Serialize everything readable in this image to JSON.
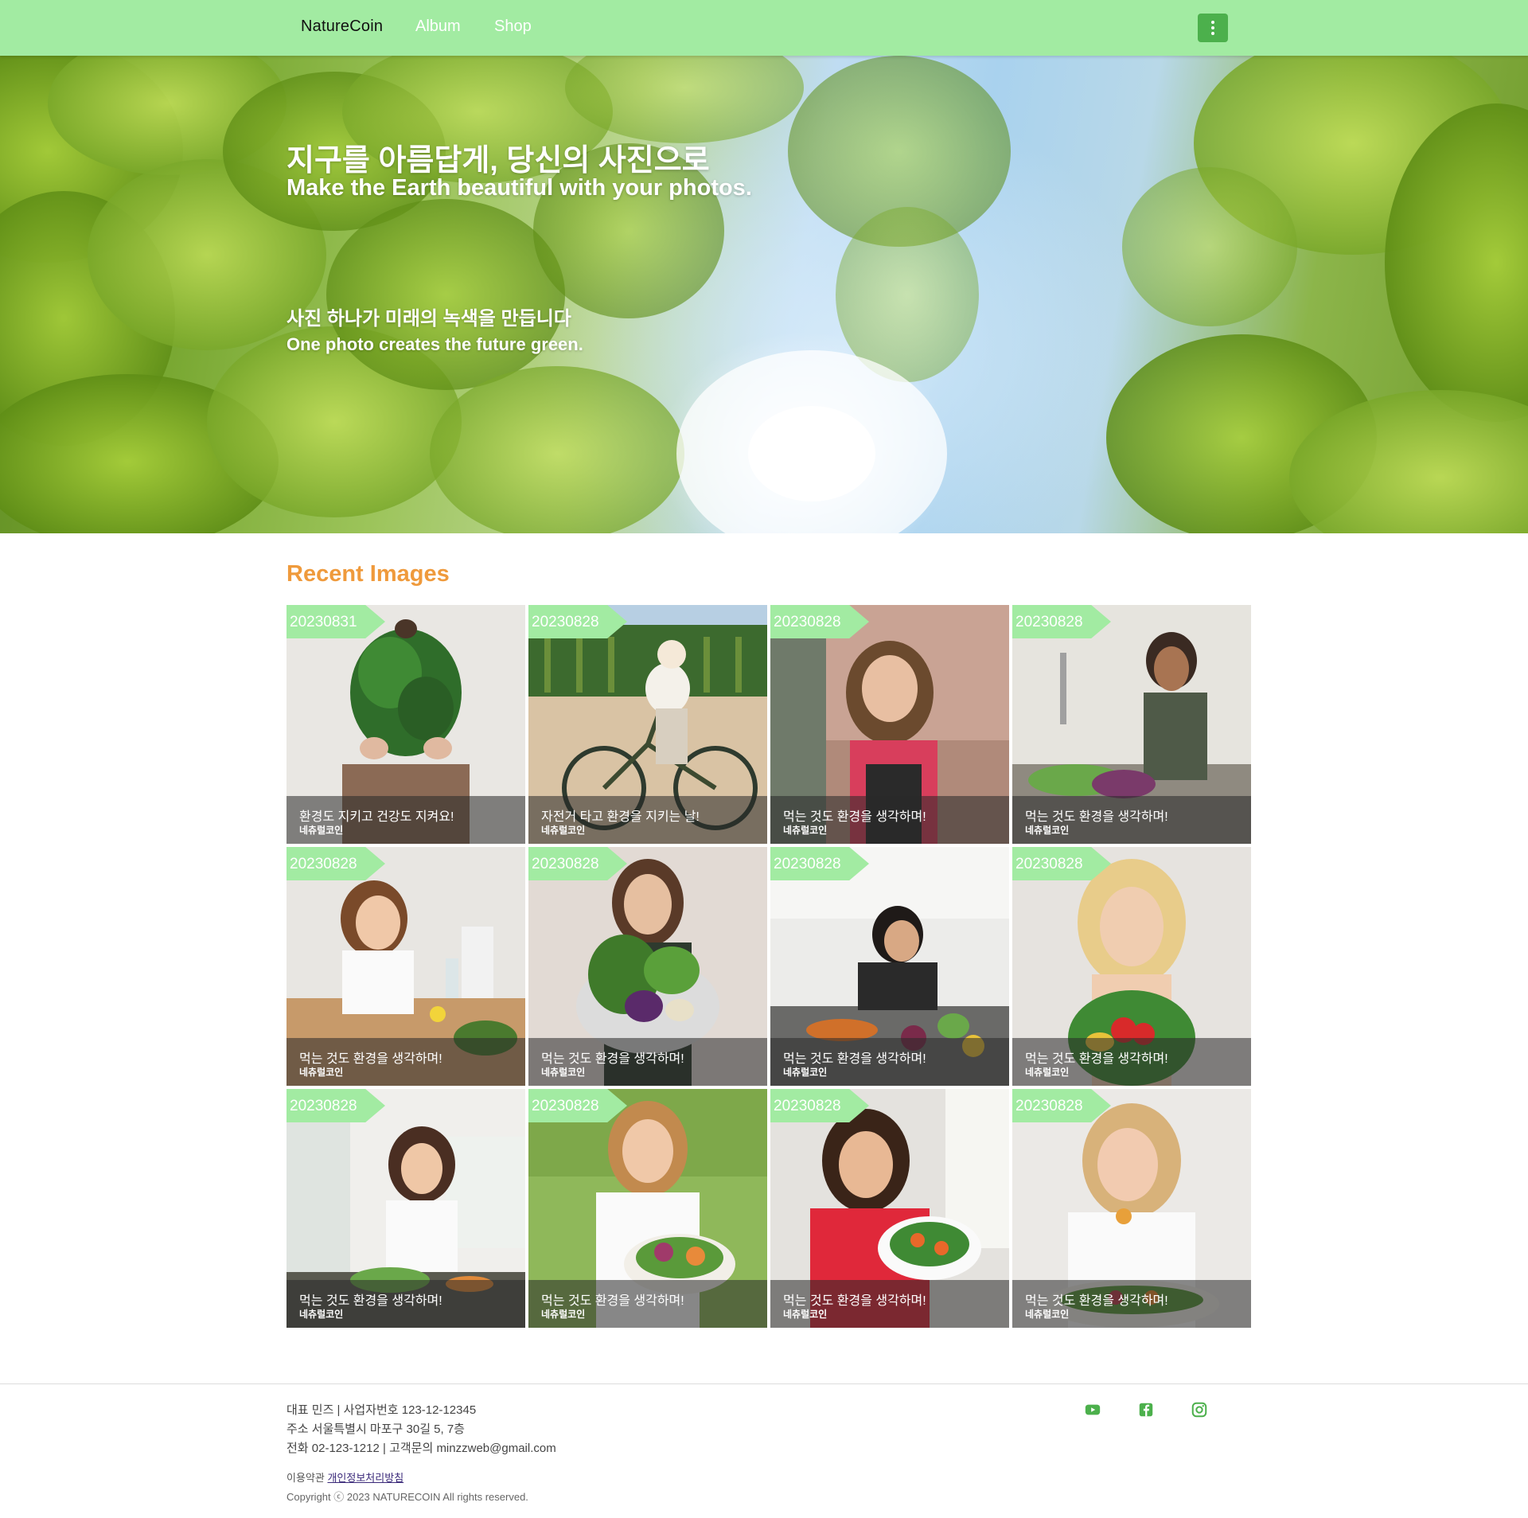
{
  "nav": {
    "brand": "NatureCoin",
    "links": [
      {
        "label": "Album"
      },
      {
        "label": "Shop"
      }
    ],
    "menu_icon": "kebab-menu-icon"
  },
  "hero": {
    "title_ko": "지구를 아름답게, 당신의 사진으로",
    "title_en": "Make the Earth beautiful with your photos.",
    "subtitle_ko": "사진 하나가 미래의 녹색을 만듭니다",
    "subtitle_en": "One photo creates the future green."
  },
  "recent": {
    "heading": "Recent Images",
    "cards": [
      {
        "date": "20230831",
        "title": "환경도 지키고 건강도 지켜요!",
        "author": "네츄럴코인",
        "theme": "greens-bouquet"
      },
      {
        "date": "20230828",
        "title": "자전거 타고 환경을 지키는 날!",
        "author": "네츄럴코인",
        "theme": "bicycle-vineyard"
      },
      {
        "date": "20230828",
        "title": "먹는 것도 환경을 생각하며!",
        "author": "네츄럴코인",
        "theme": "brick-wall-smile"
      },
      {
        "date": "20230828",
        "title": "먹는 것도 환경을 생각하며!",
        "author": "네츄럴코인",
        "theme": "kitchen-sink"
      },
      {
        "date": "20230828",
        "title": "먹는 것도 환경을 생각하며!",
        "author": "네츄럴코인",
        "theme": "table-lemon"
      },
      {
        "date": "20230828",
        "title": "먹는 것도 환경을 생각하며!",
        "author": "네츄럴코인",
        "theme": "veggie-bowl"
      },
      {
        "date": "20230828",
        "title": "먹는 것도 환경을 생각하며!",
        "author": "네츄럴코인",
        "theme": "kitchen-counter"
      },
      {
        "date": "20230828",
        "title": "먹는 것도 환경을 생각하며!",
        "author": "네츄럴코인",
        "theme": "blonde-veggies"
      },
      {
        "date": "20230828",
        "title": "먹는 것도 환경을 생각하며!",
        "author": "네츄럴코인",
        "theme": "bright-kitchen"
      },
      {
        "date": "20230828",
        "title": "먹는 것도 환경을 생각하며!",
        "author": "네츄럴코인",
        "theme": "garden-salad"
      },
      {
        "date": "20230828",
        "title": "먹는 것도 환경을 생각하며!",
        "author": "네츄럴코인",
        "theme": "red-top-salad"
      },
      {
        "date": "20230828",
        "title": "먹는 것도 환경을 생각하며!",
        "author": "네츄럴코인",
        "theme": "white-shirt-fork"
      }
    ]
  },
  "footer": {
    "line1": "대표 민즈 | 사업자번호 123-12-12345",
    "line2": "주소 서울특별시 마포구 30길 5, 7층",
    "line3": "전화 02-123-1212 | 고객문의 minzzweb@gmail.com",
    "terms": "이용약관",
    "privacy": "개인정보처리방침",
    "copyright": "Copyright ⓒ 2023 NATURECOIN All rights reserved.",
    "social": [
      "youtube-icon",
      "facebook-icon",
      "instagram-icon"
    ]
  },
  "colors": {
    "nav_bg": "#a2eba2",
    "accent_green": "#4cb04c",
    "heading_orange": "#ef9a3c",
    "tag_green": "#a2eba2"
  }
}
